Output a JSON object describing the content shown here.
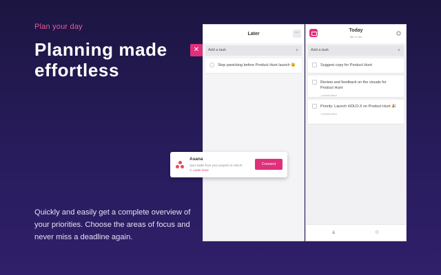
{
  "hero": {
    "eyebrow": "Plan your day",
    "headline": "Planning made effortless",
    "description": "Quickly and easily get a complete overview of your priorities. Choose the areas of focus and never miss a deadline again."
  },
  "colors": {
    "accent": "#e0307a",
    "background": "#281c5c"
  },
  "later_panel": {
    "title": "Later",
    "more_label": "···",
    "add_task": "Add a task",
    "add_icon": "+",
    "tasks": [
      {
        "text": "Stop panicking before Product Hunt launch 😉"
      }
    ]
  },
  "today_panel": {
    "title": "Today",
    "subtitle": "5th of Jan",
    "add_task": "Add a task",
    "add_icon": "+",
    "tasks": [
      {
        "text": "Suggest copy for Product Hunt",
        "meta": ""
      },
      {
        "text": "Review and feedback on the visuals for Product Hunt",
        "meta": "prioritization"
      },
      {
        "text": "Priority: Launch HOLD-X on Product Hunt 🎉",
        "meta": "prioritization"
      }
    ],
    "footer_icons": [
      "people-icon",
      "gear-icon"
    ]
  },
  "close_button": {
    "label": "✕"
  },
  "integration_card": {
    "title": "Asana",
    "text": "Sync tasks from your projects to HOLD-X.",
    "link": "Learn more",
    "button_label": "Connect"
  }
}
